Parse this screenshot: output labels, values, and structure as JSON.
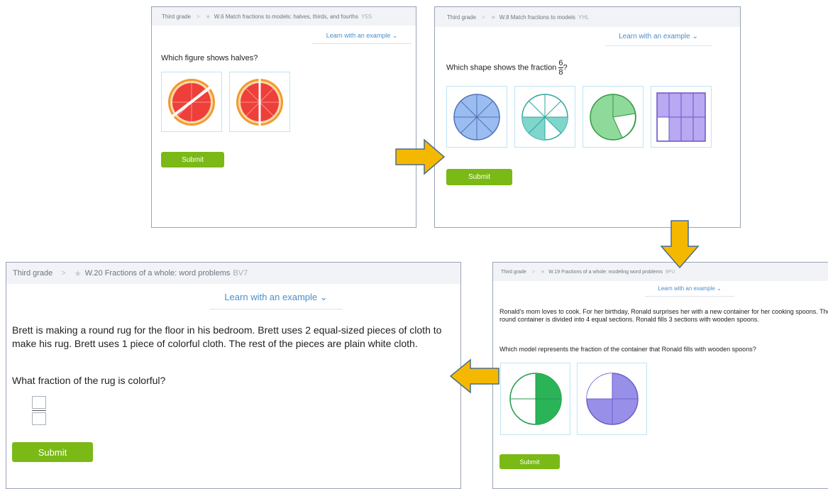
{
  "panel1": {
    "breadcrumb": {
      "grade": "Third grade",
      "skill": "W.6 Match fractions to models: halves, thirds, and fourths",
      "code": "Y5S"
    },
    "learn_link": "Learn with an example",
    "question": "Which figure shows halves?",
    "choices": [
      "grapefruit-unequal-cut",
      "grapefruit-halves"
    ],
    "submit_label": "Submit"
  },
  "panel2": {
    "breadcrumb": {
      "grade": "Third grade",
      "skill": "W.8 Match fractions to models",
      "code": "YHL"
    },
    "learn_link": "Learn with an example",
    "question_prefix": "Which shape shows the fraction",
    "fraction": {
      "numerator": "6",
      "denominator": "8"
    },
    "question_suffix": "?",
    "choices": [
      "circle-8-parts-blue",
      "circle-8-parts-teal",
      "circle-3-parts-green",
      "rectangle-8-parts-purple"
    ],
    "submit_label": "Submit"
  },
  "panel3": {
    "breadcrumb": {
      "grade": "Third grade",
      "skill": "W.19 Fractions of a whole: modeling word problems",
      "code": "9PU"
    },
    "learn_link": "Learn with an example",
    "problem": "Ronald's mom loves to cook. For her birthday, Ronald surprises her with a new container for her cooking spoons. The round container is divided into 4 equal sections. Ronald fills 3 sections with wooden spoons.",
    "question": "Which model represents the fraction of the container that Ronald fills with wooden spoons?",
    "choices": [
      "circle-4-parts-green",
      "circle-4-parts-purple"
    ],
    "submit_label": "Submit"
  },
  "panel4": {
    "breadcrumb": {
      "grade": "Third grade",
      "skill": "W.20 Fractions of a whole: word problems",
      "code": "BV7"
    },
    "learn_link": "Learn with an example",
    "problem": "Brett is making a round rug for the floor in his bedroom. Brett uses 2 equal-sized pieces of cloth to make his rug. Brett uses 1 piece of colorful cloth. The rest of the pieces are plain white cloth.",
    "question": "What fraction of the rug is colorful?",
    "submit_label": "Submit"
  },
  "colors": {
    "submit": "#7ab916",
    "link": "#4a8ec9",
    "arrow": "#f5b800",
    "arrow_outline": "#4a6d8c",
    "choice_border": "#bfe4f4"
  },
  "icons": {
    "breadcrumb_star": "star-icon",
    "learn_chevron": "chevron-down-icon",
    "arrows": "arrow-icon"
  }
}
